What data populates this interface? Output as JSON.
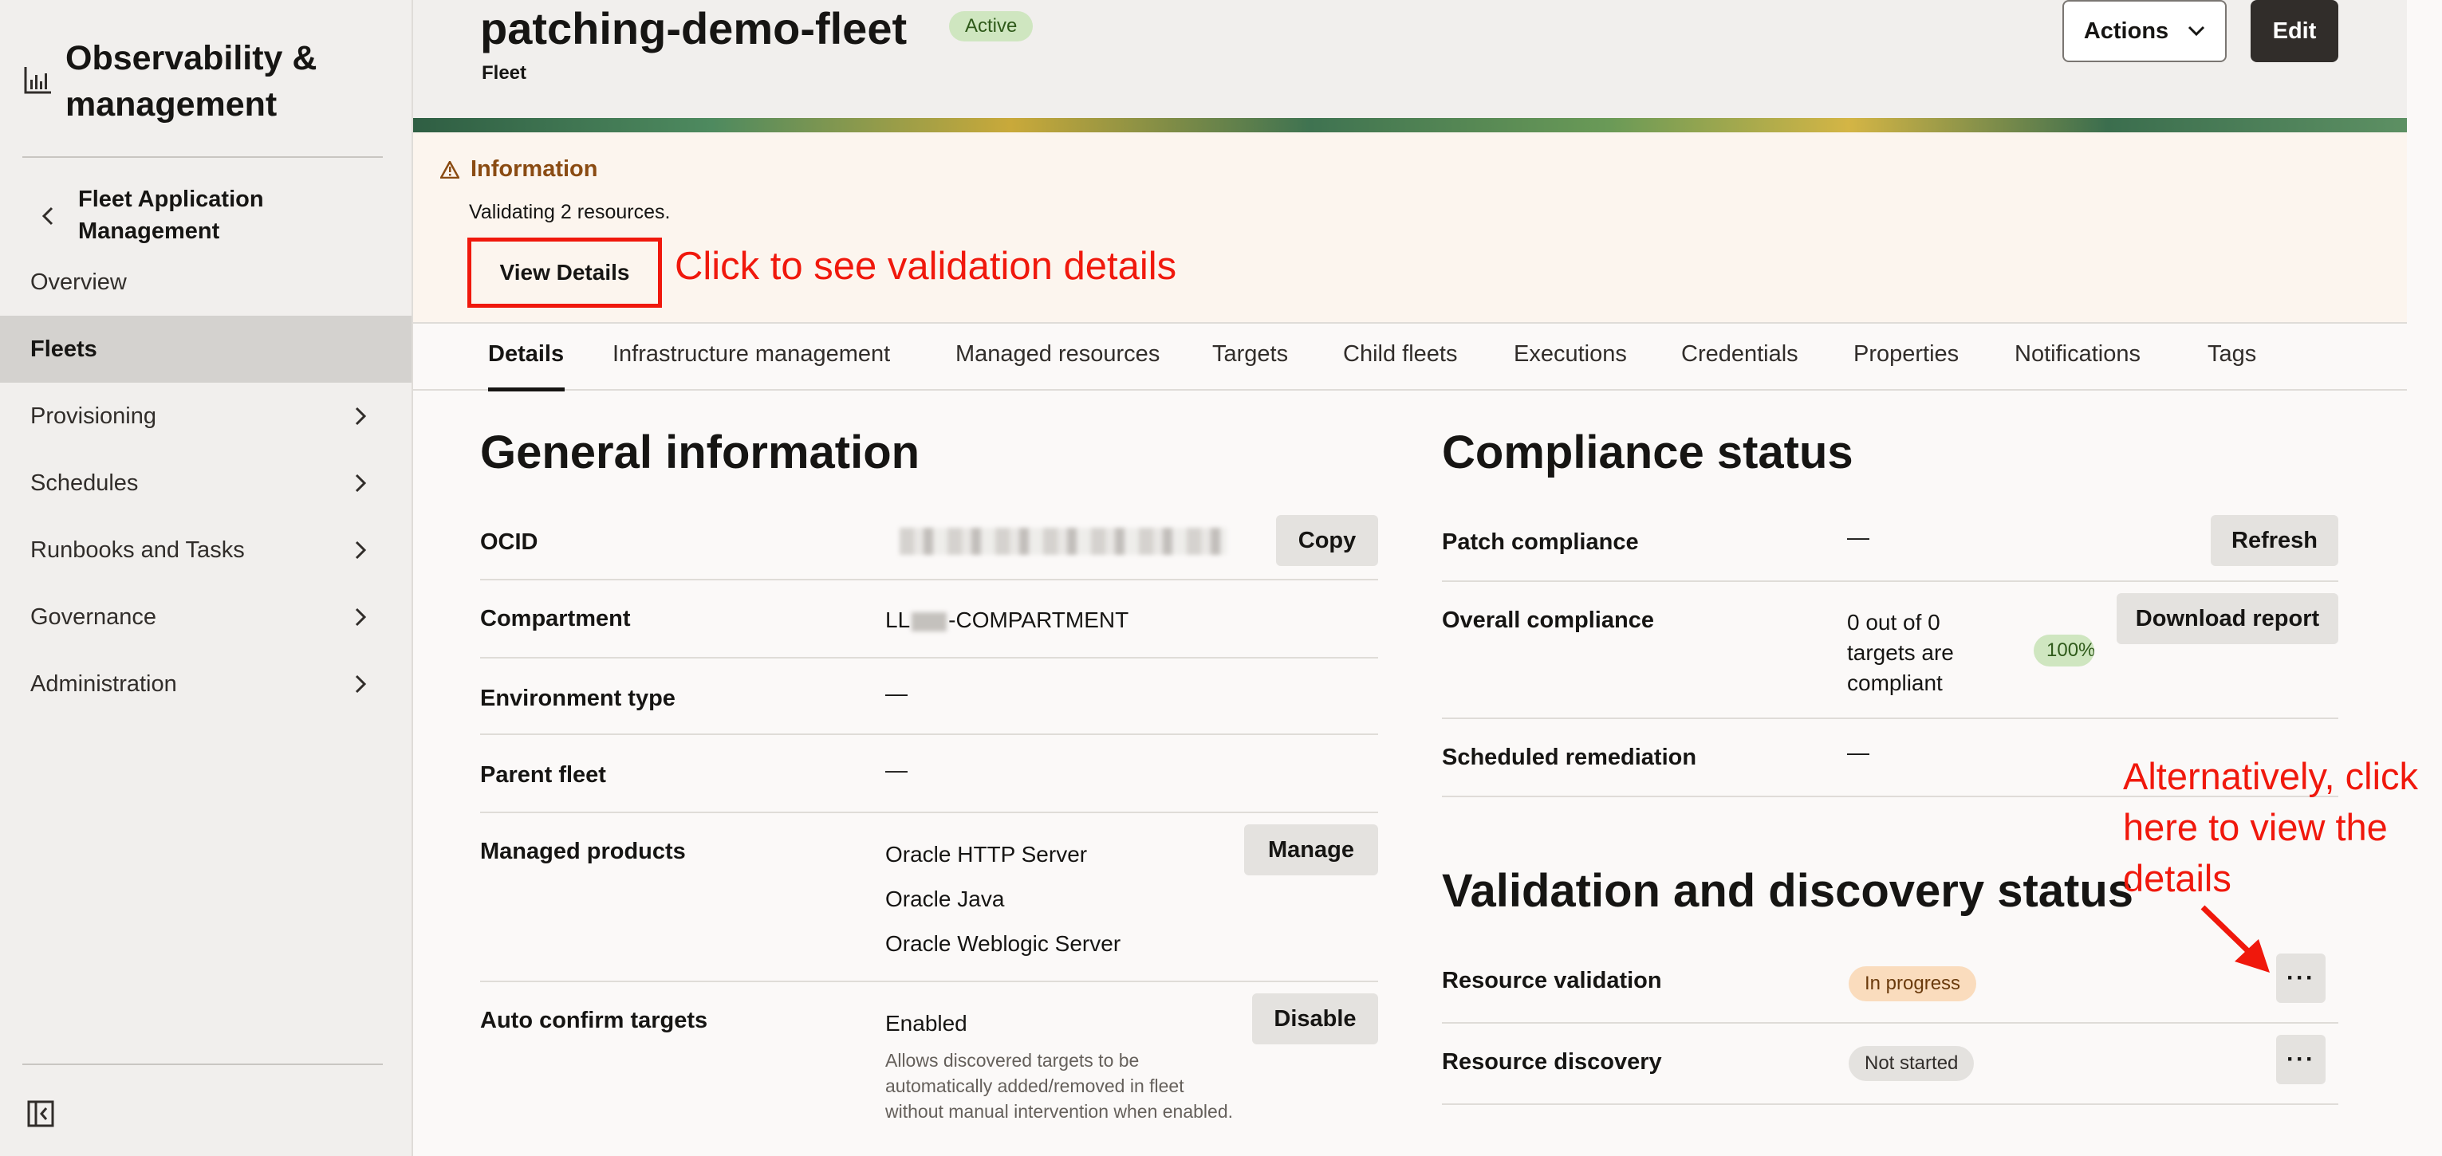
{
  "sidebar": {
    "title": "Observability & management",
    "back_label": "Fleet Application Management",
    "items": [
      {
        "label": "Overview"
      },
      {
        "label": "Fleets"
      },
      {
        "label": "Provisioning"
      },
      {
        "label": "Schedules"
      },
      {
        "label": "Runbooks and Tasks"
      },
      {
        "label": "Governance"
      },
      {
        "label": "Administration"
      }
    ]
  },
  "header": {
    "title": "patching-demo-fleet",
    "status": "Active",
    "subtitle": "Fleet",
    "actions_label": "Actions",
    "edit_label": "Edit"
  },
  "info": {
    "title": "Information",
    "message": "Validating 2 resources.",
    "view_details_label": "View Details"
  },
  "annotations": {
    "view_details_hint": "Click to see validation details",
    "dots_hint": "Alternatively, click here to view the details"
  },
  "tabs": [
    "Details",
    "Infrastructure management",
    "Managed resources",
    "Targets",
    "Child fleets",
    "Executions",
    "Credentials",
    "Properties",
    "Notifications",
    "Tags"
  ],
  "general": {
    "title": "General information",
    "ocid_label": "OCID",
    "copy_label": "Copy",
    "compartment_label": "Compartment",
    "compartment_prefix": "LL",
    "compartment_suffix": "-COMPARTMENT",
    "env_label": "Environment type",
    "env_value": "—",
    "parent_label": "Parent fleet",
    "parent_value": "—",
    "products_label": "Managed products",
    "products": [
      "Oracle HTTP Server",
      "Oracle Java",
      "Oracle Weblogic Server"
    ],
    "manage_label": "Manage",
    "autoconfirm_label": "Auto confirm targets",
    "autoconfirm_value": "Enabled",
    "disable_label": "Disable",
    "autoconfirm_note": "Allows discovered targets to be automatically added/removed in fleet without manual intervention when enabled."
  },
  "compliance": {
    "title": "Compliance status",
    "patch_label": "Patch compliance",
    "patch_value": "—",
    "refresh_label": "Refresh",
    "overall_label": "Overall compliance",
    "overall_value": "0 out of 0 targets are compliant",
    "overall_pct": "100%",
    "download_label": "Download report",
    "sched_label": "Scheduled remediation",
    "sched_value": "—"
  },
  "validation": {
    "title": "Validation and discovery status",
    "resource_validation_label": "Resource validation",
    "resource_validation_status": "In progress",
    "resource_discovery_label": "Resource discovery",
    "resource_discovery_status": "Not started",
    "more_label": "···"
  },
  "colors": {
    "annotation_red": "#f0180c",
    "active_badge": "#cfe6c0",
    "in_progress_badge": "#fadcbd",
    "info_panel_bg": "#fcf5ee",
    "primary_button": "#312d2a"
  }
}
